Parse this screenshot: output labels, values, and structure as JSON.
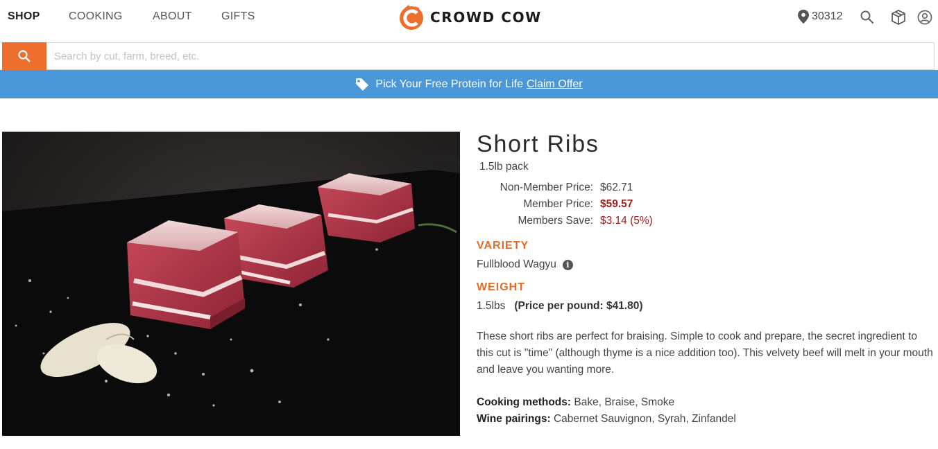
{
  "nav": {
    "links": [
      "SHOP",
      "COOKING",
      "ABOUT",
      "GIFTS"
    ],
    "brand": "CROWD COW",
    "zip": "30312",
    "icons": [
      "location-pin-icon",
      "search-icon",
      "box-icon",
      "account-icon"
    ]
  },
  "search": {
    "placeholder": "Search by cut, farm, breed, etc.",
    "value": ""
  },
  "promo": {
    "text": "Pick Your Free Protein for Life",
    "link": "Claim Offer"
  },
  "product": {
    "title": "Short Ribs",
    "pack": "1.5lb pack",
    "prices": {
      "non_member_label": "Non-Member Price:",
      "non_member_value": "$62.71",
      "member_label": "Member Price:",
      "member_value": "$59.57",
      "save_label": "Members Save:",
      "save_value": "$3.14 (5%)"
    },
    "variety_heading": "VARIETY",
    "variety_value": "Fullblood Wagyu",
    "weight_heading": "WEIGHT",
    "weight_value": "1.5lbs",
    "price_per_pound": "(Price per pound: $41.80)",
    "description": "These short ribs are perfect for braising. Simple to cook and prepare, the secret ingredient to this cut is \"time\" (although thyme is a nice addition too). This velvety beef will melt in your mouth and leave you wanting more.",
    "cooking_label": "Cooking methods:",
    "cooking_value": "Bake, Braise, Smoke",
    "wine_label": "Wine pairings:",
    "wine_value": "Cabernet Sauvignon, Syrah, Zinfandel"
  },
  "colors": {
    "brand_orange": "#ee6f2d",
    "promo_blue": "#4a97d9",
    "member_red": "#a01e1e",
    "section_orange": "#e36b25"
  }
}
